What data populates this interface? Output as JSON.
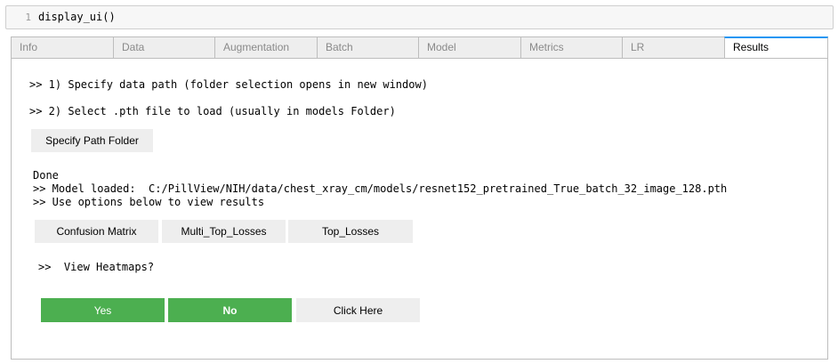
{
  "code_cell": {
    "line_number": "1",
    "code": "display_ui()"
  },
  "tabs": [
    {
      "label": "Info"
    },
    {
      "label": "Data"
    },
    {
      "label": "Augmentation"
    },
    {
      "label": "Batch"
    },
    {
      "label": "Model"
    },
    {
      "label": "Metrics"
    },
    {
      "label": "LR"
    },
    {
      "label": "Results"
    }
  ],
  "active_tab": "Results",
  "results": {
    "step1": ">> 1) Specify data path (folder selection opens in new window)",
    "step2": ">> 2) Select .pth file to load (usually in models Folder)",
    "specify_path_button": "Specify Path Folder",
    "output_lines": [
      "Done",
      ">> Model loaded:  C:/PillView/NIH/data/chest_xray_cm/models/resnet152_pretrained_True_batch_32_image_128.pth",
      ">> Use options below to view results"
    ],
    "result_buttons": [
      "Confusion Matrix",
      "Multi_Top_Losses",
      "Top_Losses"
    ],
    "heatmap_prompt": ">>  View Heatmaps?",
    "yes_button": "Yes",
    "no_button": "No",
    "click_here_button": "Click Here"
  },
  "colors": {
    "accent_tab_border": "#2196f3",
    "green_button": "#4caf50",
    "gray_button": "#eeeeee"
  }
}
